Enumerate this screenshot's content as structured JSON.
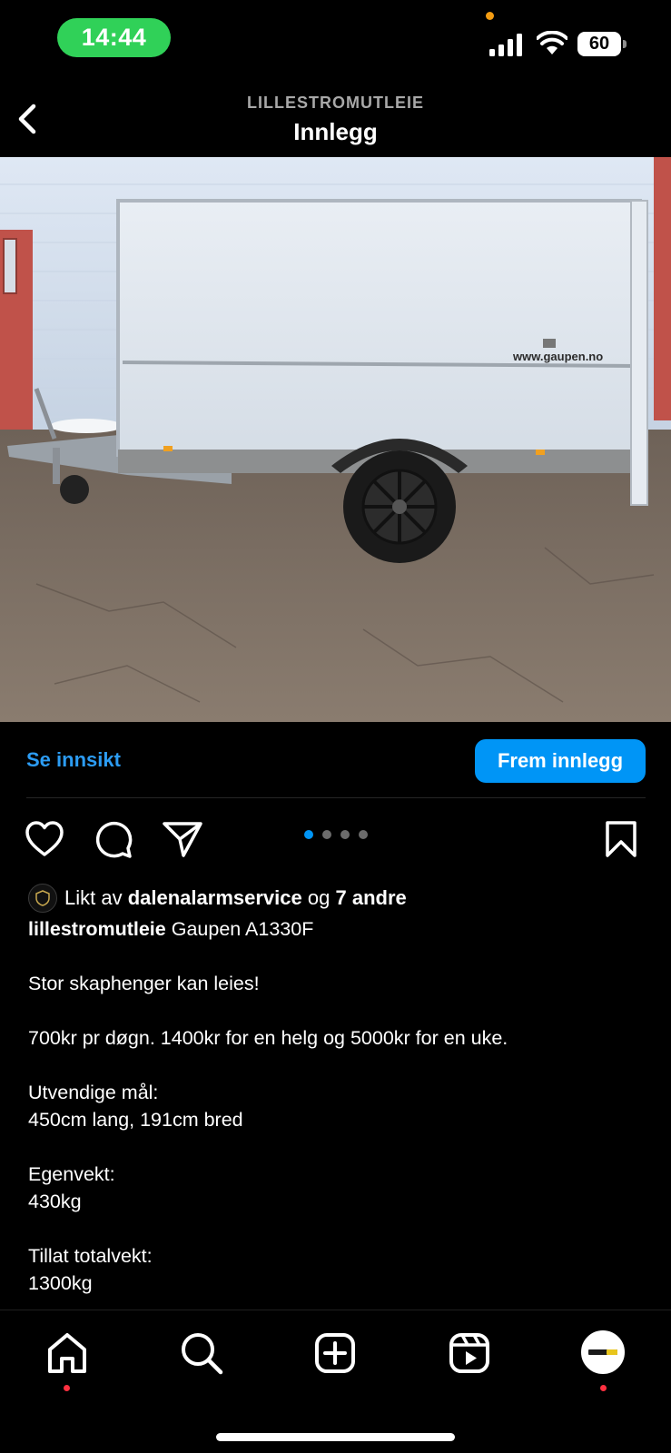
{
  "status_bar": {
    "time": "14:44",
    "battery": "60",
    "signal_icon": "cellular-signal-icon",
    "wifi_icon": "wifi-icon",
    "time_pill_color": "#30d158"
  },
  "header": {
    "account": "LILLESTROMUTLEIE",
    "title": "Innlegg",
    "back_icon": "chevron-left-icon"
  },
  "post": {
    "image_description_icon": "trailer-photo",
    "image_text": "www.gaupen.no",
    "insights_label": "Se innsikt",
    "promote_label": "Frem innlegg",
    "carousel": {
      "count": 4,
      "active_index": 0
    },
    "likes": {
      "prefix": "Likt av",
      "user": "dalenalarmservice",
      "connector": "og",
      "others": "7 andre"
    },
    "caption": {
      "username": "lillestromutleie",
      "first_line": "Gaupen A1330F",
      "lines": [
        "",
        "Stor skaphenger kan leies!",
        "",
        "700kr pr døgn. 1400kr for en helg og 5000kr for en uke.",
        "",
        "Utvendige mål:",
        "450cm lang, 191cm bred",
        "",
        "Egenvekt:",
        "430kg",
        "",
        "Tillat totalvekt:",
        "1300kg"
      ]
    }
  },
  "nav": {
    "items": [
      "home-icon",
      "search-icon",
      "create-icon",
      "reels-icon",
      "profile-avatar"
    ]
  },
  "colors": {
    "accent": "#0095f6",
    "link": "#2c9cf3",
    "badge": "#ff3040"
  }
}
